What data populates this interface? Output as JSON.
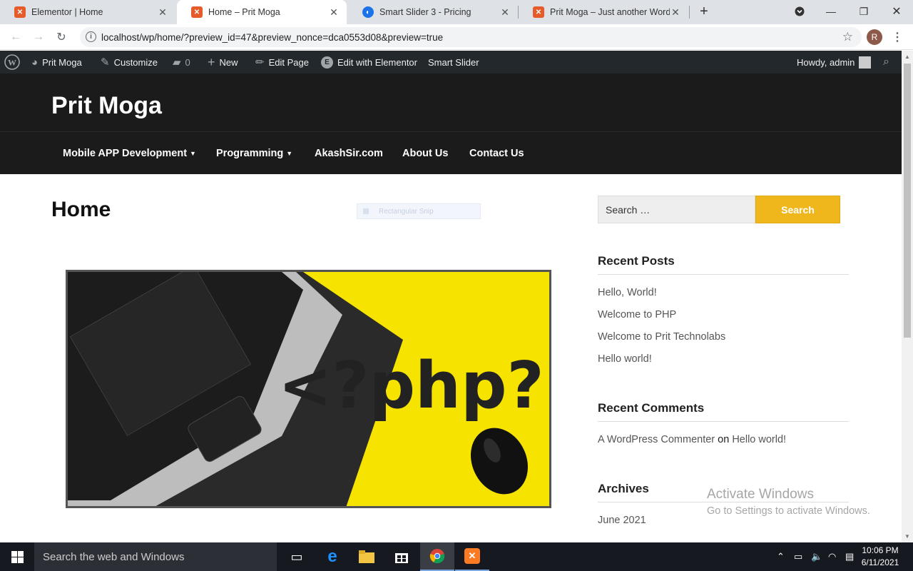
{
  "browser": {
    "tabs": [
      {
        "label": "Elementor | Home",
        "active": false
      },
      {
        "label": "Home – Prit Moga",
        "active": true
      },
      {
        "label": "Smart Slider 3 - Pricing",
        "active": false
      },
      {
        "label": "Prit Moga – Just another WordPr",
        "active": false
      }
    ],
    "url": "localhost/wp/home/?preview_id=47&preview_nonce=dca0553d08&preview=true",
    "profile_initial": "R"
  },
  "admin_bar": {
    "site_name": "Prit Moga",
    "customize": "Customize",
    "comments_count": "0",
    "new": "New",
    "edit_page": "Edit Page",
    "edit_elementor": "Edit with Elementor",
    "smart_slider": "Smart Slider",
    "howdy": "Howdy, admin"
  },
  "site": {
    "title": "Prit Moga",
    "nav": [
      {
        "label": "Mobile APP Development",
        "has_submenu": true
      },
      {
        "label": "Programming",
        "has_submenu": true
      },
      {
        "label": "AkashSir.com",
        "has_submenu": false
      },
      {
        "label": "About Us",
        "has_submenu": false
      },
      {
        "label": "Contact Us",
        "has_submenu": false
      }
    ]
  },
  "main": {
    "page_title": "Home",
    "snip_ghost": "Rectangular Snip",
    "hero_text": "<?php?>"
  },
  "sidebar": {
    "search_placeholder": "Search …",
    "search_button": "Search",
    "recent_posts_title": "Recent Posts",
    "recent_posts": [
      "Hello, World!",
      "Welcome to PHP",
      "Welcome to Prit Technolabs",
      "Hello world!"
    ],
    "recent_comments_title": "Recent Comments",
    "comment_author": "A WordPress Commenter",
    "comment_on": "on",
    "comment_post": "Hello world!",
    "archives_title": "Archives",
    "archives": [
      "June 2021"
    ]
  },
  "watermark": {
    "title": "Activate Windows",
    "subtitle": "Go to Settings to activate Windows."
  },
  "taskbar": {
    "search_placeholder": "Search the web and Windows",
    "time": "10:06 PM",
    "date": "6/11/2021"
  },
  "colors": {
    "header_bg": "#1b1b1b",
    "admin_bar_bg": "#23282d",
    "search_button": "#f0b71d",
    "hero_bg": "#f6e300"
  }
}
